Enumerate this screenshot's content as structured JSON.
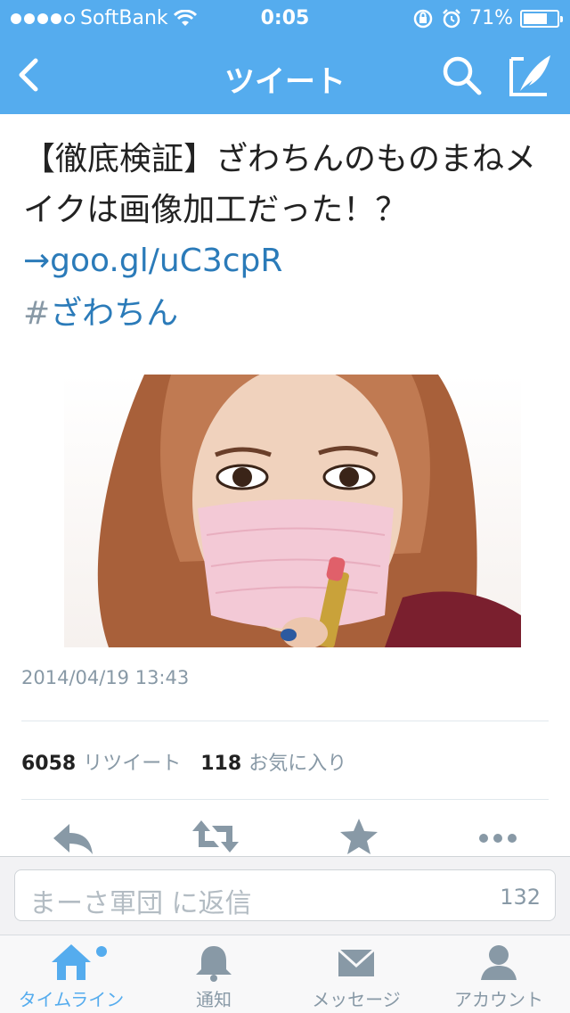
{
  "status_bar": {
    "carrier": "SoftBank",
    "time": "0:05",
    "battery": "71%",
    "battery_level": 0.71
  },
  "nav": {
    "title": "ツイート"
  },
  "tweet": {
    "text": "【徹底検証】ざわちんのものまねメイクは画像加工だった！？",
    "link": "→goo.gl/uC3cpR",
    "hashtag_symbol": "#",
    "hashtag": "ざわちん",
    "timestamp": "2014/04/19 13:43",
    "retweet_count": "6058",
    "retweet_label": "リツイート",
    "favorite_count": "118",
    "favorite_label": "お気に入り"
  },
  "reply": {
    "placeholder": "まーさ軍団 に返信",
    "char_count": "132"
  },
  "tabs": [
    {
      "label": "タイムライン",
      "icon": "home-icon",
      "active": true
    },
    {
      "label": "通知",
      "icon": "bell-icon",
      "active": false
    },
    {
      "label": "メッセージ",
      "icon": "envelope-icon",
      "active": false
    },
    {
      "label": "アカウント",
      "icon": "person-icon",
      "active": false
    }
  ],
  "colors": {
    "accent": "#55acee",
    "link": "#2b7bb9",
    "muted": "#8899a6"
  }
}
